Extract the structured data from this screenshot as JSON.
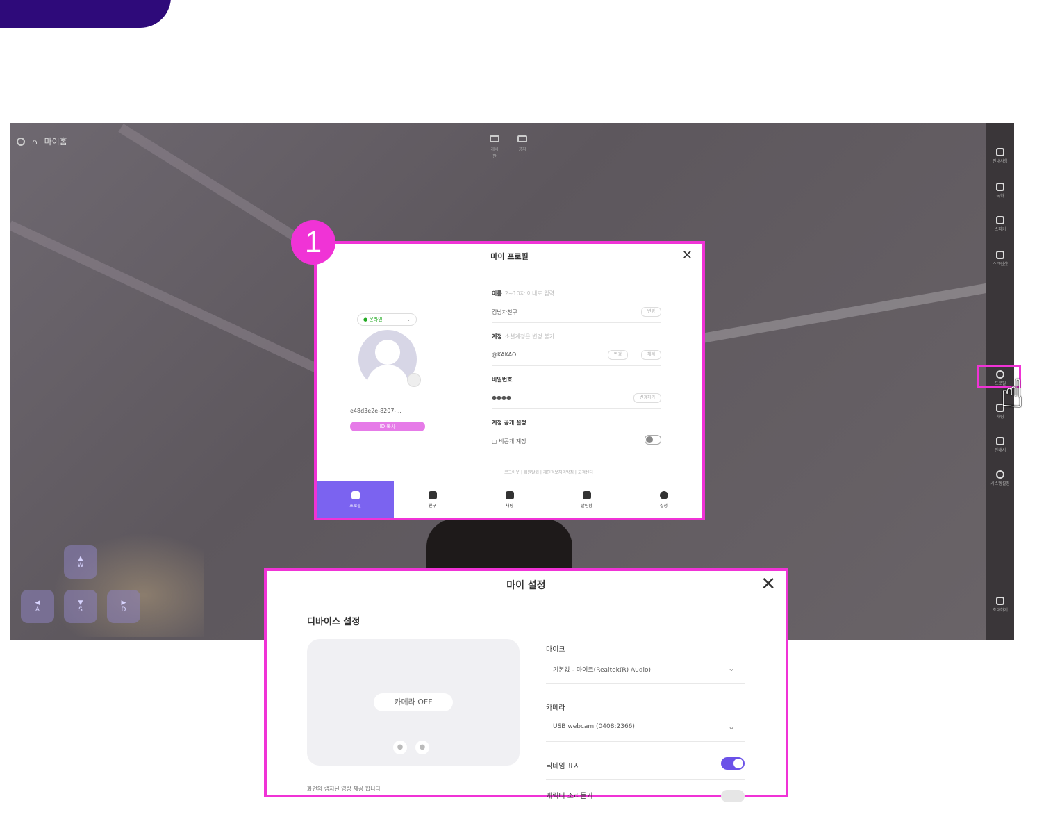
{
  "app": {
    "location_label": "마이홈",
    "top_icons": [
      {
        "icon": "board-icon",
        "label": "게시판"
      },
      {
        "icon": "board-icon",
        "label": "공지"
      }
    ],
    "right_bar": [
      {
        "icon": "document-icon",
        "label": "안내사항"
      },
      {
        "icon": "camera-icon",
        "label": "녹화"
      },
      {
        "icon": "speaker-icon",
        "label": "스피커"
      },
      {
        "icon": "capture-icon",
        "label": "스크린샷"
      },
      {
        "icon": "profile-icon",
        "label": "프로필"
      },
      {
        "icon": "chat-icon",
        "label": "채팅"
      },
      {
        "icon": "book-icon",
        "label": "안내서"
      },
      {
        "icon": "gear-icon",
        "label": "시스템설정"
      },
      {
        "icon": "user-add-icon",
        "label": "초대하기"
      }
    ],
    "keys": {
      "w": "W",
      "a": "A",
      "s": "S",
      "d": "D"
    }
  },
  "badge": {
    "number": "1"
  },
  "profile": {
    "title": "마이 프로필",
    "status": "● 온라인",
    "user_id": "e48d3e2e-8207-...",
    "id_button": "ID 복사",
    "fields": [
      {
        "label": "이름",
        "hint": "2~10자 이내로 입력",
        "value": "김남자친구",
        "button": "변경"
      },
      {
        "label": "계정",
        "hint": "소셜계정은 변경 불가",
        "value": "@KAKAO",
        "buttons": [
          "변경",
          "해제"
        ]
      },
      {
        "label": "비밀번호",
        "hint": "",
        "value": "●●●●",
        "button": "변경하기"
      },
      {
        "label": "계정 공개 설정",
        "hint": "",
        "value": "비공개 계정"
      }
    ],
    "links": "로그아웃 | 회원탈퇴 | 개인정보처리방침 | 고객센터",
    "tabs": [
      {
        "label": "프로필",
        "icon": "profile-icon",
        "active": true
      },
      {
        "label": "친구",
        "icon": "friends-icon",
        "active": false
      },
      {
        "label": "채팅",
        "icon": "chat-icon",
        "active": false
      },
      {
        "label": "알림함",
        "icon": "bell-icon",
        "active": false
      },
      {
        "label": "설정",
        "icon": "gear-icon",
        "active": false
      }
    ]
  },
  "settings": {
    "title": "마이 설정",
    "section": "디바이스 설정",
    "camera_off": "카메라 OFF",
    "bottom_note": "화면의 캡처된 영상 제공 합니다",
    "mic_label": "마이크",
    "mic_value": "기본값 - 마이크(Realtek(R) Audio)",
    "camera_label": "카메라",
    "camera_value": "USB webcam (0408:2366)",
    "nickname_label": "닉네임 표시",
    "nickname_on": true,
    "next_label": "캐릭터 소리듣기"
  },
  "colors": {
    "accent": "#f033d6",
    "brand": "#7b63f0",
    "banner": "#2e0a7a"
  }
}
